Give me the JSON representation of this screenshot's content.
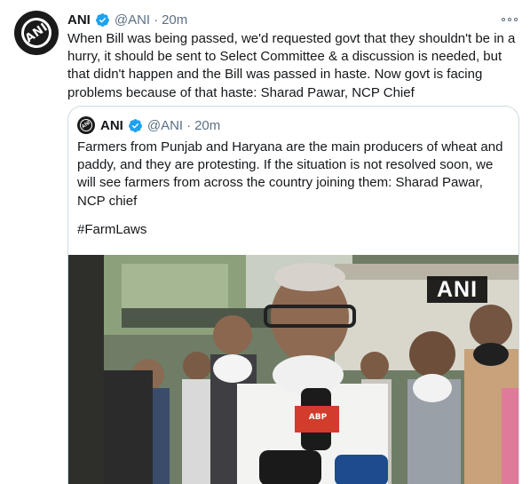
{
  "tweet": {
    "author_name": "ANI",
    "handle": "@ANI",
    "separator": "·",
    "time": "20m",
    "avatar_text": "ANI",
    "text": "When Bill was being passed, we'd requested govt that they shouldn't be in a hurry, it should be sent to Select Committee & a discussion is needed, but that didn't happen and the Bill was passed in haste. Now govt is facing problems because of that haste: Sharad Pawar, NCP Chief"
  },
  "quoted_tweet": {
    "author_name": "ANI",
    "handle": "@ANI",
    "separator": "·",
    "time": "20m",
    "avatar_text": "ANI",
    "text": "Farmers from Punjab and Haryana are the main producers of wheat and paddy, and they are protesting. If the situation is not resolved soon, we will see farmers from across the country joining them: Sharad Pawar, NCP chief",
    "hashtag": "#FarmLaws",
    "media": {
      "watermark": "ANI",
      "mic_label": "ABP"
    }
  },
  "colors": {
    "verified": "#1da1f2",
    "secondary_text": "#5b7083",
    "border": "#cfd9de"
  },
  "icons": {
    "more": "more-horizontal-icon",
    "verified": "verified-badge-icon"
  }
}
